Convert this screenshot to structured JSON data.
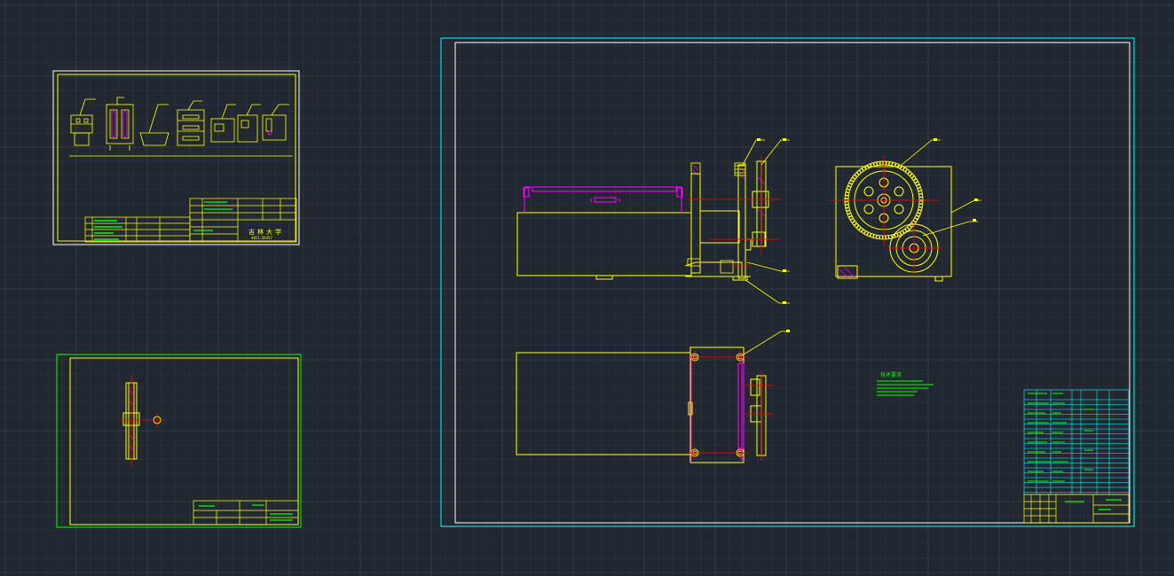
{
  "colors": {
    "background": "#212830",
    "grid_minor": "#2a313a",
    "grid_major": "#323a44",
    "yellow": "#ffff00",
    "white": "#ffffff",
    "cyan": "#00ffff",
    "green": "#00ff00",
    "magenta": "#ff00ff",
    "red": "#ff0000"
  },
  "sheet1": {
    "title_block": {
      "company": "吉林大学",
      "drawing_no": "4811.30457"
    }
  },
  "sheet3": {
    "tech_requirements_title": "技术要求"
  },
  "icons": [
    "leader-bubble-icon",
    "centerline-cross-icon"
  ]
}
